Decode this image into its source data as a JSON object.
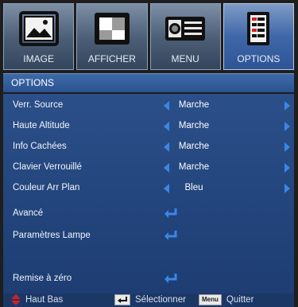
{
  "tabs": [
    {
      "label": "IMAGE",
      "icon": "picture-icon",
      "active": false
    },
    {
      "label": "AFFICHER",
      "icon": "display-icon",
      "active": false
    },
    {
      "label": "MENU",
      "icon": "projector-icon",
      "active": false
    },
    {
      "label": "OPTIONS",
      "icon": "options-list-icon",
      "active": true
    }
  ],
  "section_title": "OPTIONS",
  "rows": [
    {
      "label": "Verr. Source",
      "value": "Marche",
      "type": "select"
    },
    {
      "label": "Haute Altitude",
      "value": "Marche",
      "type": "select"
    },
    {
      "label": "Info Cachées",
      "value": "Marche",
      "type": "select"
    },
    {
      "label": "Clavier Verrouillé",
      "value": "Marche",
      "type": "select"
    },
    {
      "label": "Couleur Arr Plan",
      "value": "Bleu",
      "type": "select"
    },
    {
      "label": "Avancé",
      "type": "enter"
    },
    {
      "label": "Paramètres Lampe",
      "type": "enter"
    },
    {
      "label": "Remise à zéro",
      "type": "enter"
    }
  ],
  "footer": {
    "nav_label": "Haut Bas",
    "select_label": "Sélectionner",
    "menu_key": "Menu",
    "quit_label": "Quitter"
  },
  "colors": {
    "background": "#1e1e1e",
    "menu_blue": "#2b4f89",
    "arrow_blue": "#3b86e6",
    "nav_red": "#d62020"
  }
}
